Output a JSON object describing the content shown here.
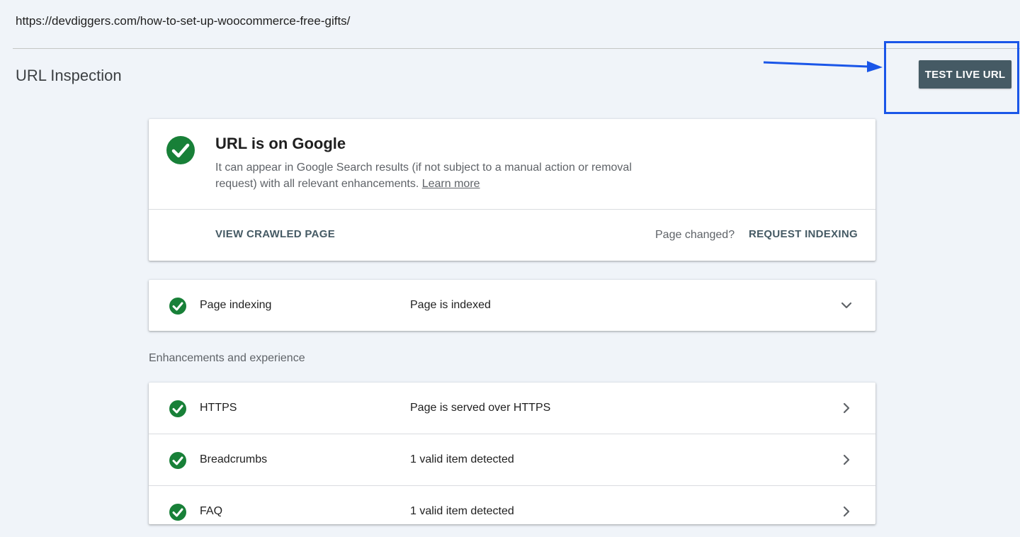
{
  "url": "https://devdiggers.com/how-to-set-up-woocommerce-free-gifts/",
  "page_title": "URL Inspection",
  "toolbar": {
    "test_live_url": "TEST LIVE URL"
  },
  "status": {
    "title": "URL is on Google",
    "description": "It can appear in Google Search results (if not subject to a manual action or removal request) with all relevant enhancements.",
    "learn_more": "Learn more",
    "view_crawled_page": "VIEW CRAWLED PAGE",
    "page_changed": "Page changed?",
    "request_indexing": "REQUEST INDEXING"
  },
  "indexing": {
    "label": "Page indexing",
    "value": "Page is indexed",
    "icon": "chevron-down-icon"
  },
  "enhancements": {
    "heading": "Enhancements and experience",
    "items": [
      {
        "label": "HTTPS",
        "value": "Page is served over HTTPS",
        "icon": "chevron-right-icon"
      },
      {
        "label": "Breadcrumbs",
        "value": "1 valid item detected",
        "icon": "chevron-right-icon"
      },
      {
        "label": "FAQ",
        "value": "1 valid item detected",
        "icon": "chevron-right-icon"
      }
    ]
  },
  "colors": {
    "success": "#188038",
    "button": "#455a64",
    "annotation": "#1a56e8",
    "background": "#f0f4f9"
  }
}
